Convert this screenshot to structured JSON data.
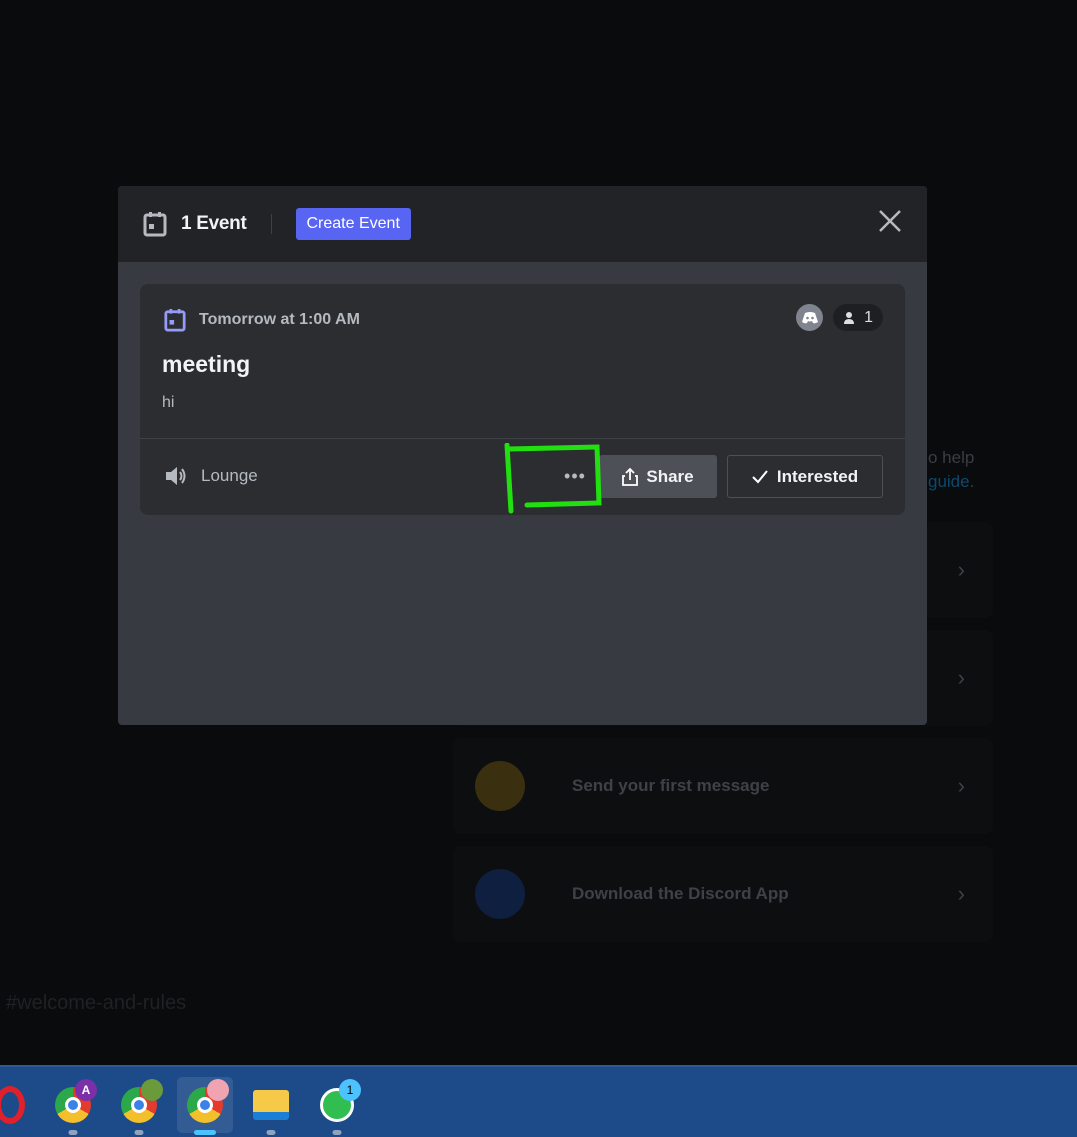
{
  "background": {
    "help_text": "o help",
    "guide_link": "guide",
    "guide_period": ".",
    "cards": [
      {
        "label": ""
      },
      {
        "label": ""
      },
      {
        "label": "Send your first message",
        "icon": "chat-bubble-icon"
      },
      {
        "label": "Download the Discord App",
        "icon": "phone-icon"
      }
    ],
    "channel": "#welcome-and-rules"
  },
  "modal": {
    "title": "1 Event",
    "create_label": "Create Event",
    "event": {
      "when": "Tomorrow at 1:00 AM",
      "name": "meeting",
      "description": "hi",
      "interested_count": "1",
      "location": "Lounge",
      "more_label": "•••",
      "share_label": "Share",
      "interested_label": "Interested"
    }
  },
  "colors": {
    "accent": "#5865f2",
    "annotation": "#22e010"
  },
  "taskbar": {
    "apps": [
      {
        "name": "Opera"
      },
      {
        "name": "Chrome",
        "profile": "A",
        "profile_color": "#7b2fa8"
      },
      {
        "name": "Chrome",
        "profile_color": "#6a9a3a"
      },
      {
        "name": "Chrome",
        "profile_color": "#f0a3b0",
        "active": true
      },
      {
        "name": "File Explorer"
      },
      {
        "name": "WhatsApp",
        "badge": "1"
      }
    ]
  }
}
